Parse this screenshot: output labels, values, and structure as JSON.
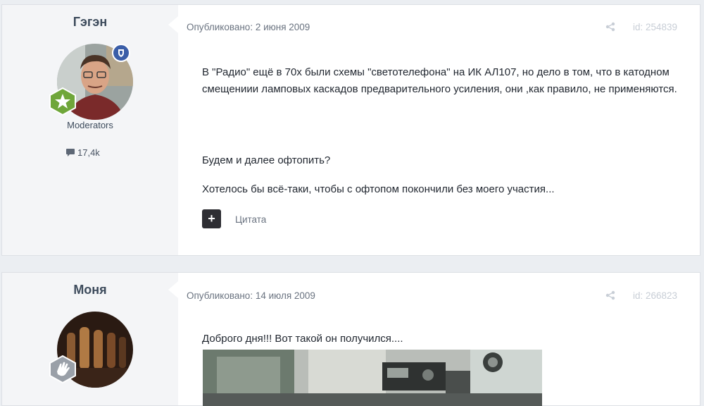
{
  "posts": [
    {
      "author": "Гэгэн",
      "group": "Moderators",
      "post_count": "17,4k",
      "published": "Опубликовано: 2 июня 2009",
      "id_label": "id: 254839",
      "paragraphs": [
        "В \"Радио\" ещё в 70х были схемы \"светотелефона\" на ИК АЛ107, но дело в том, что в катодном смещениии ламповых каскадов предварительного усиления, они ,как правило, не применяются.",
        "Будем и далее офтопить?",
        "Хотелось бы всё-таки, чтобы с офтопом покончили без моего участия..."
      ],
      "quote_button": "+",
      "quote_label": "Цитата"
    },
    {
      "author": "Моня",
      "published": "Опубликовано: 14 июля 2009",
      "id_label": "id: 266823",
      "paragraphs": [
        "Доброго дня!!! Вот такой он получился...."
      ]
    }
  ],
  "icons": {
    "rank_badge": "star-badge-icon",
    "moderator_badge": "shield-icon",
    "post_count": "speech-bubble-icon",
    "share": "share-icon",
    "rank_badge_2": "hand-badge-icon"
  },
  "colors": {
    "rank_green": "#6fa63a",
    "moderator_blue": "#3b5ea8",
    "page_bg": "#ebeef2",
    "author_col_bg": "#f4f5f7"
  }
}
